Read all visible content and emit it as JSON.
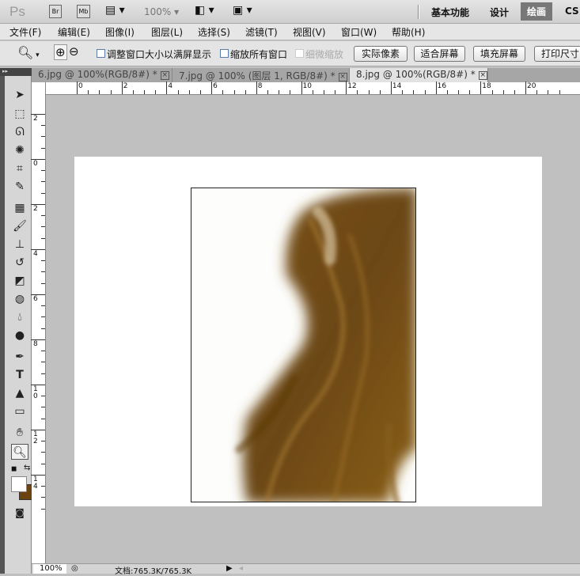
{
  "appbar": {
    "logo": "Ps",
    "bridge": "Br",
    "minibridge": "Mb",
    "zoom": "100%",
    "workspaces": [
      "基本功能",
      "设计",
      "绘画",
      "CS"
    ]
  },
  "menu": [
    "文件(F)",
    "编辑(E)",
    "图像(I)",
    "图层(L)",
    "选择(S)",
    "滤镜(T)",
    "视图(V)",
    "窗口(W)",
    "帮助(H)"
  ],
  "options": {
    "resize_windows": "调整窗口大小以满屏显示",
    "zoom_all": "缩放所有窗口",
    "scrubby_zoom": "细微缩放",
    "actual_pixels": "实际像素",
    "fit_screen": "适合屏幕",
    "fill_screen": "填充屏幕",
    "print_size": "打印尺寸"
  },
  "tabs": [
    {
      "label": "6.jpg @ 100%(RGB/8#) *"
    },
    {
      "label": "7.jpg @ 100% (图层 1, RGB/8#) *"
    },
    {
      "label": "8.jpg @ 100%(RGB/8#) *"
    }
  ],
  "hruler": [
    "0",
    "2",
    "4",
    "6",
    "8",
    "10",
    "12",
    "14",
    "16",
    "18",
    "20"
  ],
  "vruler": [
    "2",
    "0",
    "2",
    "4",
    "6",
    "8",
    "1\n0",
    "1\n2",
    "1\n4"
  ],
  "status": {
    "zoom": "100%",
    "doc": "文档:765.3K/765.3K"
  },
  "colors": {
    "foreground": "#ffffff",
    "background": "#6b4310"
  }
}
